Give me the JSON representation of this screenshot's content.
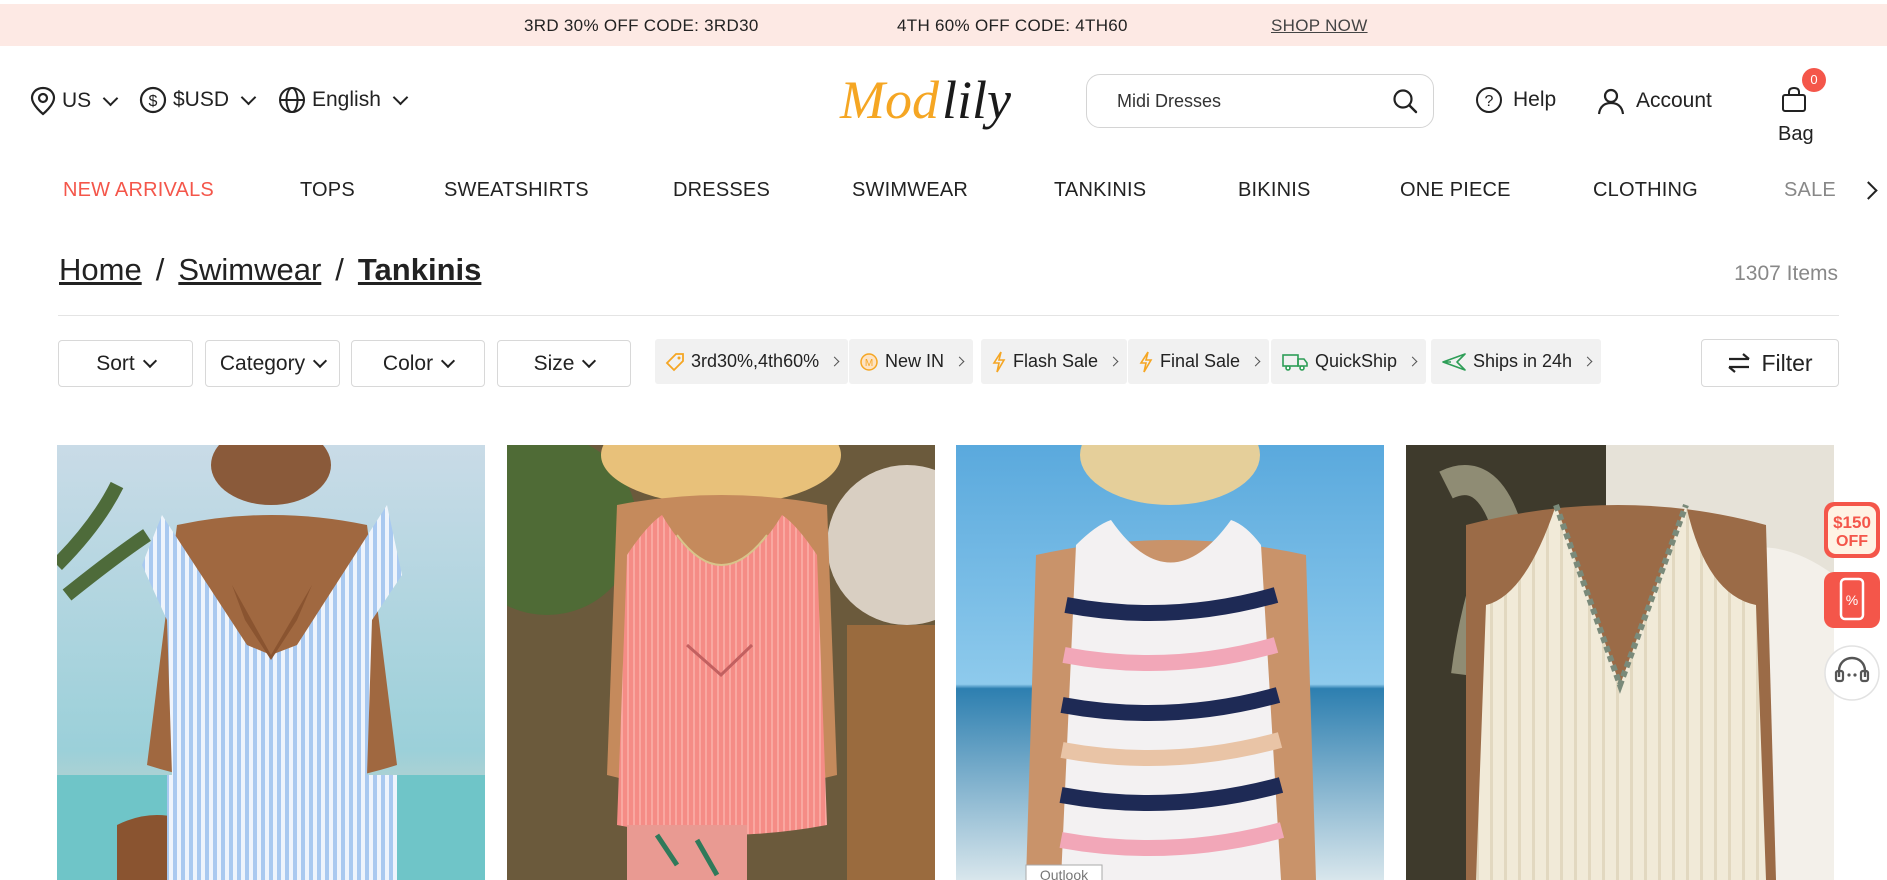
{
  "promo": {
    "offer1": "3RD 30% OFF   CODE: 3RD30",
    "offer2": "4TH 60% OFF   CODE: 4TH60",
    "shop_now": "SHOP NOW"
  },
  "header": {
    "region": "US",
    "currency": "$USD",
    "language": "English",
    "logo_text": "Modlily",
    "search_value": "Midi Dresses",
    "help": "Help",
    "account": "Account",
    "bag_label": "Bag",
    "bag_count": "0"
  },
  "nav": {
    "items": [
      "NEW ARRIVALS",
      "TOPS",
      "SWEATSHIRTS",
      "DRESSES",
      "SWIMWEAR",
      "TANKINIS",
      "BIKINIS",
      "ONE PIECE",
      "CLOTHING",
      "SALE"
    ]
  },
  "breadcrumb": {
    "home": "Home",
    "sep": "/",
    "swimwear": "Swimwear",
    "current": "Tankinis"
  },
  "item_count": "1307 Items",
  "filters": {
    "sort": "Sort",
    "category": "Category",
    "color": "Color",
    "size": "Size",
    "chips": [
      "3rd30%,4th60%",
      "New IN",
      "Flash Sale",
      "Final Sale",
      "QuickShip",
      "Ships in 24h"
    ],
    "filter_button": "Filter"
  },
  "products": [
    {
      "name": "Blue striped ruffle V-neck tankini top",
      "icon": "product-image"
    },
    {
      "name": "Pink ribbed scoop neck tankini top",
      "icon": "product-image"
    },
    {
      "name": "Navy and pink tie-dye stripe tankini top",
      "icon": "product-image",
      "tag": "Outlook"
    },
    {
      "name": "Cream ruched halter tankini top",
      "icon": "product-image"
    }
  ],
  "side_floats": {
    "coupon_line1": "$150",
    "coupon_line2": "OFF",
    "app_badge": "%"
  },
  "colors": {
    "accent": "#f4564a",
    "promo_bg": "#fde9e4",
    "logo_orange": "#f5a623"
  }
}
